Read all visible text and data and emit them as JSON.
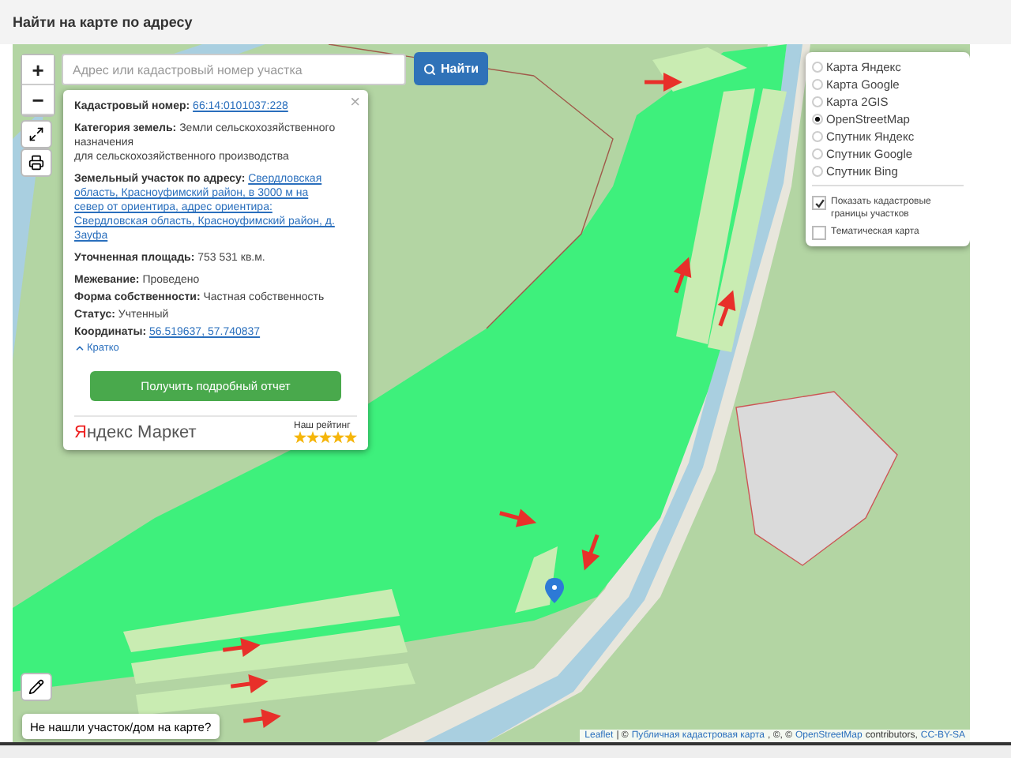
{
  "header": {
    "title": "Найти на карте по адресу"
  },
  "search": {
    "placeholder": "Адрес или кадастровый номер участка",
    "button": "Найти"
  },
  "zoom_controls": [
    "+",
    "−"
  ],
  "popup": {
    "groups": [
      [
        {
          "label": "Кадастровый номер:",
          "kind": "link",
          "lines": [
            "66:14:0101037:228"
          ]
        }
      ],
      [
        {
          "label": "Категория земель:",
          "kind": "text",
          "lines": [
            "Земли сельскохозяйственного назначения",
            "для сельскохозяйственного производства"
          ]
        }
      ],
      [
        {
          "label": "Земельный участок по адресу:",
          "kind": "link",
          "lines": [
            "Свердловская область, Красноуфимский район, в 3000 м на север от ориентира, адрес ориентира: Свердловская область, Красноуфимский район, д. Зауфа"
          ]
        }
      ],
      [
        {
          "label": "Уточненная площадь:",
          "kind": "text",
          "lines": [
            "753 531 кв.м."
          ]
        }
      ],
      [
        {
          "label": "Межевание:",
          "kind": "text",
          "lines": [
            "Проведено"
          ]
        },
        {
          "label": "Форма собственности:",
          "kind": "text",
          "lines": [
            "Частная собственность"
          ]
        },
        {
          "label": "Статус:",
          "kind": "text",
          "lines": [
            "Учтенный"
          ]
        },
        {
          "label": "Координаты:",
          "kind": "link",
          "lines": [
            "56.519637, 57.740837"
          ]
        }
      ]
    ],
    "collapse_link": "Кратко",
    "report_button": "Получить подробный отчет",
    "brand": "Яндекс Маркет",
    "rating_label": "Наш рейтинг",
    "stars": 5,
    "close": "×"
  },
  "layers": {
    "base_maps": [
      {
        "label": "Карта Яндекс",
        "selected": false
      },
      {
        "label": "Карта Google",
        "selected": false
      },
      {
        "label": "Карта 2GIS",
        "selected": false
      },
      {
        "label": "OpenStreetMap",
        "selected": true
      },
      {
        "label": "Спутник Яндекс",
        "selected": false
      },
      {
        "label": "Спутник Google",
        "selected": false
      },
      {
        "label": "Спутник Bing",
        "selected": false
      }
    ],
    "overlays": [
      {
        "label": "Показать кадастровые границы участков",
        "checked": true
      },
      {
        "label": "Тематическая карта",
        "checked": false
      }
    ]
  },
  "not_found_button": "Не нашли участок/дом на карте?",
  "attribution": [
    {
      "kind": "link",
      "text": "Leaflet"
    },
    {
      "kind": "text",
      "text": "| ©"
    },
    {
      "kind": "link",
      "text": "Публичная кадастровая карта"
    },
    {
      "kind": "text",
      "text": ", ©, ©"
    },
    {
      "kind": "link",
      "text": "OpenStreetMap"
    },
    {
      "kind": "text",
      "text": "contributors,"
    },
    {
      "kind": "link",
      "text": "CC-BY-SA"
    }
  ]
}
